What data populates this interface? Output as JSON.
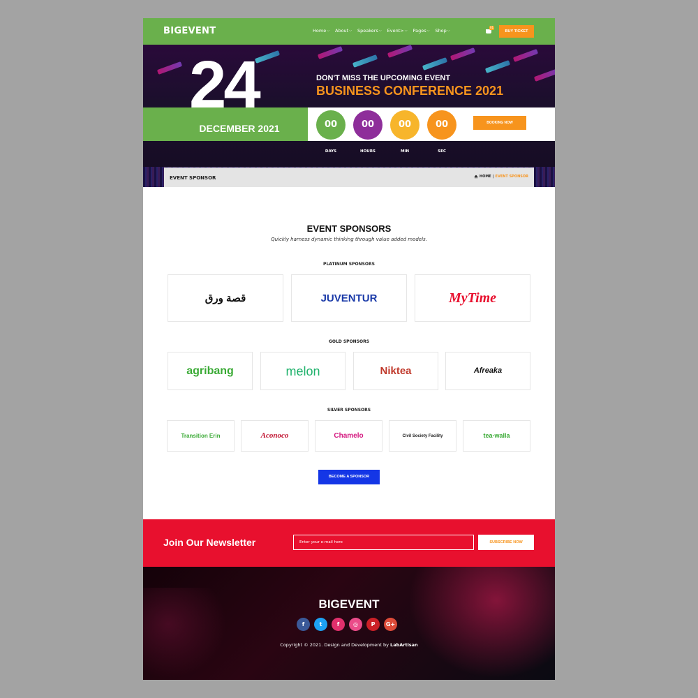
{
  "header": {
    "brand": "BIGEVENT",
    "nav": [
      "Home",
      "About",
      "Speakers",
      "Event>",
      "Pages",
      "Shop"
    ],
    "cart_count": "01",
    "buy_ticket": "BUY TICKET"
  },
  "hero": {
    "day": "24",
    "month_year": "DECEMBER 2021",
    "kicker": "DON'T MISS THE UPCOMING EVENT",
    "title": "BUSINESS CONFERENCE 2021",
    "countdown": [
      {
        "value": "00",
        "label": "DAYS",
        "color": "#6ab04c"
      },
      {
        "value": "00",
        "label": "HOURS",
        "color": "#8e2e9a"
      },
      {
        "value": "00",
        "label": "MIN",
        "color": "#f7b52b"
      },
      {
        "value": "00",
        "label": "SEC",
        "color": "#f7941d"
      }
    ],
    "booking": "BOOKING NOW"
  },
  "breadcrumb": {
    "page_title": "EVENT SPONSOR",
    "home": "HOME",
    "separator": "|",
    "current": "EVENT SPONSOR"
  },
  "sponsors": {
    "title": "EVENT SPONSORS",
    "subtitle": "Quickly harness dynamic thinking through value added models.",
    "platinum": {
      "label": "PLATINUM SPONSORS",
      "logos": [
        "قصة ورق",
        "JUVENTUR",
        "MyTime"
      ]
    },
    "gold": {
      "label": "GOLD SPONSORS",
      "logos": [
        "agribang",
        "melon",
        "Niktea",
        "Afreaka"
      ]
    },
    "silver": {
      "label": "SILVER SPONSORS",
      "logos": [
        "Transition Erin",
        "Aconoco",
        "Chamelo",
        "Civil Society Facility",
        "tea-walla"
      ]
    },
    "become": "BECOME A SPONSOR"
  },
  "newsletter": {
    "title": "Join Our Newsletter",
    "placeholder": "Enter your e-mail here",
    "button": "SUBSCRIBE NOW"
  },
  "footer": {
    "brand": "BIGEVENT",
    "socials": [
      {
        "icon": "facebook-icon",
        "glyph": "f",
        "color": "#3b5998"
      },
      {
        "icon": "twitter-icon",
        "glyph": "t",
        "color": "#1da1f2"
      },
      {
        "icon": "facebook-alt-icon",
        "glyph": "f",
        "color": "#e1306c"
      },
      {
        "icon": "dribbble-icon",
        "glyph": "◎",
        "color": "#ea4c89"
      },
      {
        "icon": "pinterest-icon",
        "glyph": "P",
        "color": "#cb2027"
      },
      {
        "icon": "google-plus-icon",
        "glyph": "G+",
        "color": "#dd4b39"
      }
    ],
    "copyright_prefix": "Copyright © 2021. Design and Development by",
    "copyright_author": "LabArtisan"
  }
}
